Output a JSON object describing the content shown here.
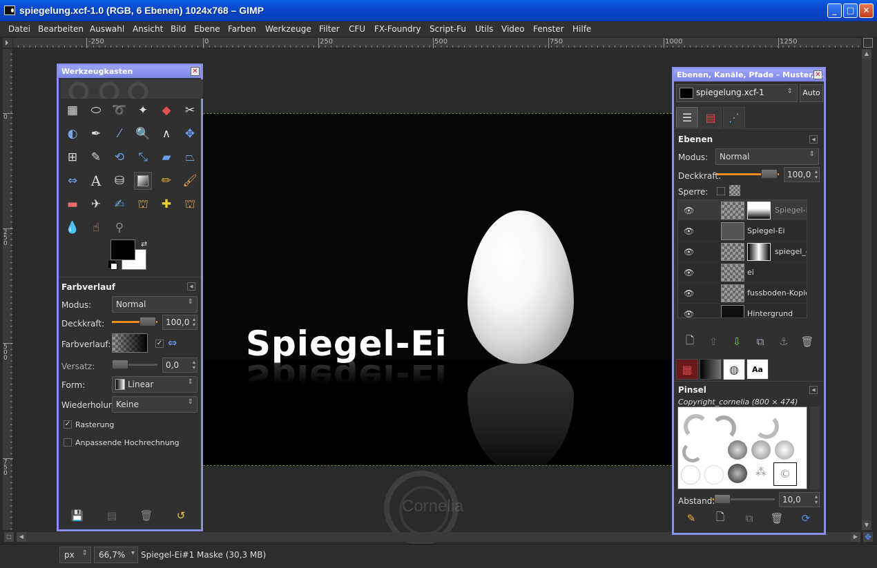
{
  "window": {
    "title": "spiegelung.xcf-1.0 (RGB, 6 Ebenen) 1024x768 – GIMP",
    "buttons": {
      "minimize": "_",
      "maximize": "□",
      "close": "✕"
    }
  },
  "menubar": [
    "Datei",
    "Bearbeiten",
    "Auswahl",
    "Ansicht",
    "Bild",
    "Ebene",
    "Farben",
    "Werkzeuge",
    "Filter",
    "CFU",
    "FX-Foundry",
    "Script-Fu",
    "Utils",
    "Video",
    "Fenster",
    "Hilfe"
  ],
  "rulers": {
    "horizontal": [
      "-250",
      "0",
      "250",
      "500",
      "750",
      "1000",
      "1250"
    ],
    "vertical": [
      "0",
      "250",
      "500",
      "750"
    ]
  },
  "canvas": {
    "text": "Spiegel-Ei",
    "watermark": "Cornelia"
  },
  "statusbar": {
    "unit": "px",
    "zoom": "66,7%",
    "message": "Spiegel-Ei#1 Maske (30,3 MB)"
  },
  "toolbox": {
    "title": "Werkzeugkasten",
    "close": "✕",
    "tool_icons": [
      "rect-select-icon",
      "ellipse-select-icon",
      "lasso-icon",
      "fuzzy-select-icon",
      "color-select-icon",
      "scissors-icon",
      "foreground-select-icon",
      "paths-icon",
      "color-picker-icon",
      "zoom-icon",
      "measure-icon",
      "move-icon",
      "align-icon",
      "crop-icon",
      "rotate-icon",
      "scale-icon",
      "shear-icon",
      "perspective-icon",
      "flip-icon",
      "text-icon",
      "bucket-fill-icon",
      "blend-icon",
      "pencil-icon",
      "paintbrush-icon",
      "eraser-icon",
      "airbrush-icon",
      "ink-icon",
      "clone-icon",
      "heal-icon",
      "perspective-clone-icon",
      "blur-icon",
      "smudge-icon",
      "dodge-burn-icon"
    ],
    "tool_options": {
      "title": "Farbverlauf",
      "mode_label": "Modus:",
      "mode_value": "Normal",
      "opacity_label": "Deckkraft:",
      "opacity_value": "100,0",
      "opacity_fraction": 1.0,
      "gradient_label": "Farbverlauf:",
      "gradient_reverse_check": "✓",
      "offset_label": "Versatz:",
      "offset_value": "0,0",
      "shape_label": "Form:",
      "shape_value": "Linear",
      "repeat_label": "Wiederholung:",
      "repeat_value": "Keine",
      "dither_check": "✓",
      "dither_label": "Rasterung",
      "supersample_label": "Anpassende Hochrechnung"
    }
  },
  "layers_dock": {
    "title": "Ebenen, Kanäle, Pfade – Muster, F...",
    "close": "✕",
    "image_combo": "spiegelung.xcf-1",
    "auto_button": "Auto",
    "layers": {
      "title": "Ebenen",
      "mode_label": "Modus:",
      "mode_value": "Normal",
      "opacity_label": "Deckkraft:",
      "opacity_value": "100,0",
      "opacity_fraction": 1.0,
      "lock_label": "Sperre:",
      "items": [
        {
          "name": "Spiegel-Ei",
          "has_mask": true,
          "selected": true
        },
        {
          "name": "Spiegel-Ei",
          "has_mask": false,
          "selected": false
        },
        {
          "name": "spiegel_ei",
          "has_mask": true,
          "selected": false
        },
        {
          "name": "ei",
          "has_mask": false,
          "selected": false
        },
        {
          "name": "fussboden-Kopie",
          "has_mask": false,
          "selected": false
        },
        {
          "name": "Hintergrund",
          "has_mask": false,
          "selected": false
        }
      ]
    },
    "brushes": {
      "title": "Pinsel",
      "current": "Copyright_cornelia (800 × 474)",
      "spacing_label": "Abstand:",
      "spacing_value": "10,0"
    }
  }
}
